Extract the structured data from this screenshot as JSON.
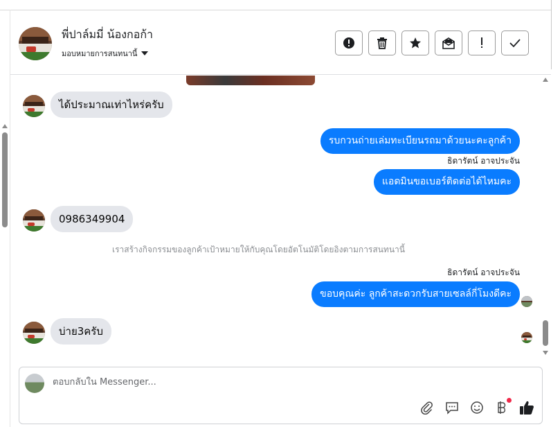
{
  "header": {
    "contact_name": "พี่ปาล์มมี่ น้องกอก้า",
    "assign_label": "มอบหมายการสนทนานี้",
    "toolbar": [
      {
        "name": "spam-button",
        "icon": "alert-circle-icon"
      },
      {
        "name": "delete-button",
        "icon": "trash-icon"
      },
      {
        "name": "star-button",
        "icon": "star-icon"
      },
      {
        "name": "mark-unread-button",
        "icon": "envelope-icon"
      },
      {
        "name": "follow-up-button",
        "icon": "exclamation-icon"
      },
      {
        "name": "done-button",
        "icon": "check-icon"
      }
    ]
  },
  "messages": {
    "m1": "ได้ประมาณเท่าไหร่ครับ",
    "m2": "รบกวนถ่ายเล่มทะเบียนรถมาด้วยนะคะลูกค้า",
    "m2_sender": "ธิดารัตน์ อาจประจัน",
    "m3": "แอดมินขอเบอร์ติดต่อได้ไหมคะ",
    "m4": "0986349904",
    "system_note": "เราสร้างกิจกรรมของลูกค้าเป้าหมายให้กับคุณโดยอัตโนมัติโดยอิงตามการสนทนานี้",
    "m5_sender": "ธิดารัตน์ อาจประจัน",
    "m5": "ขอบคุณค่ะ ลูกค้าสะดวกรับสายเซลล์กี่โมงดีคะ",
    "m6": "บ่าย3ครับ"
  },
  "composer": {
    "placeholder": "ตอบกลับใน Messenger...",
    "icons": [
      "paperclip-icon",
      "chat-bubble-icon",
      "emoji-icon",
      "baht-icon",
      "thumbs-up-icon"
    ]
  },
  "colors": {
    "outgoing_bubble": "#0a7cff",
    "incoming_bubble": "#e4e6eb",
    "notification_dot": "#f02849"
  }
}
